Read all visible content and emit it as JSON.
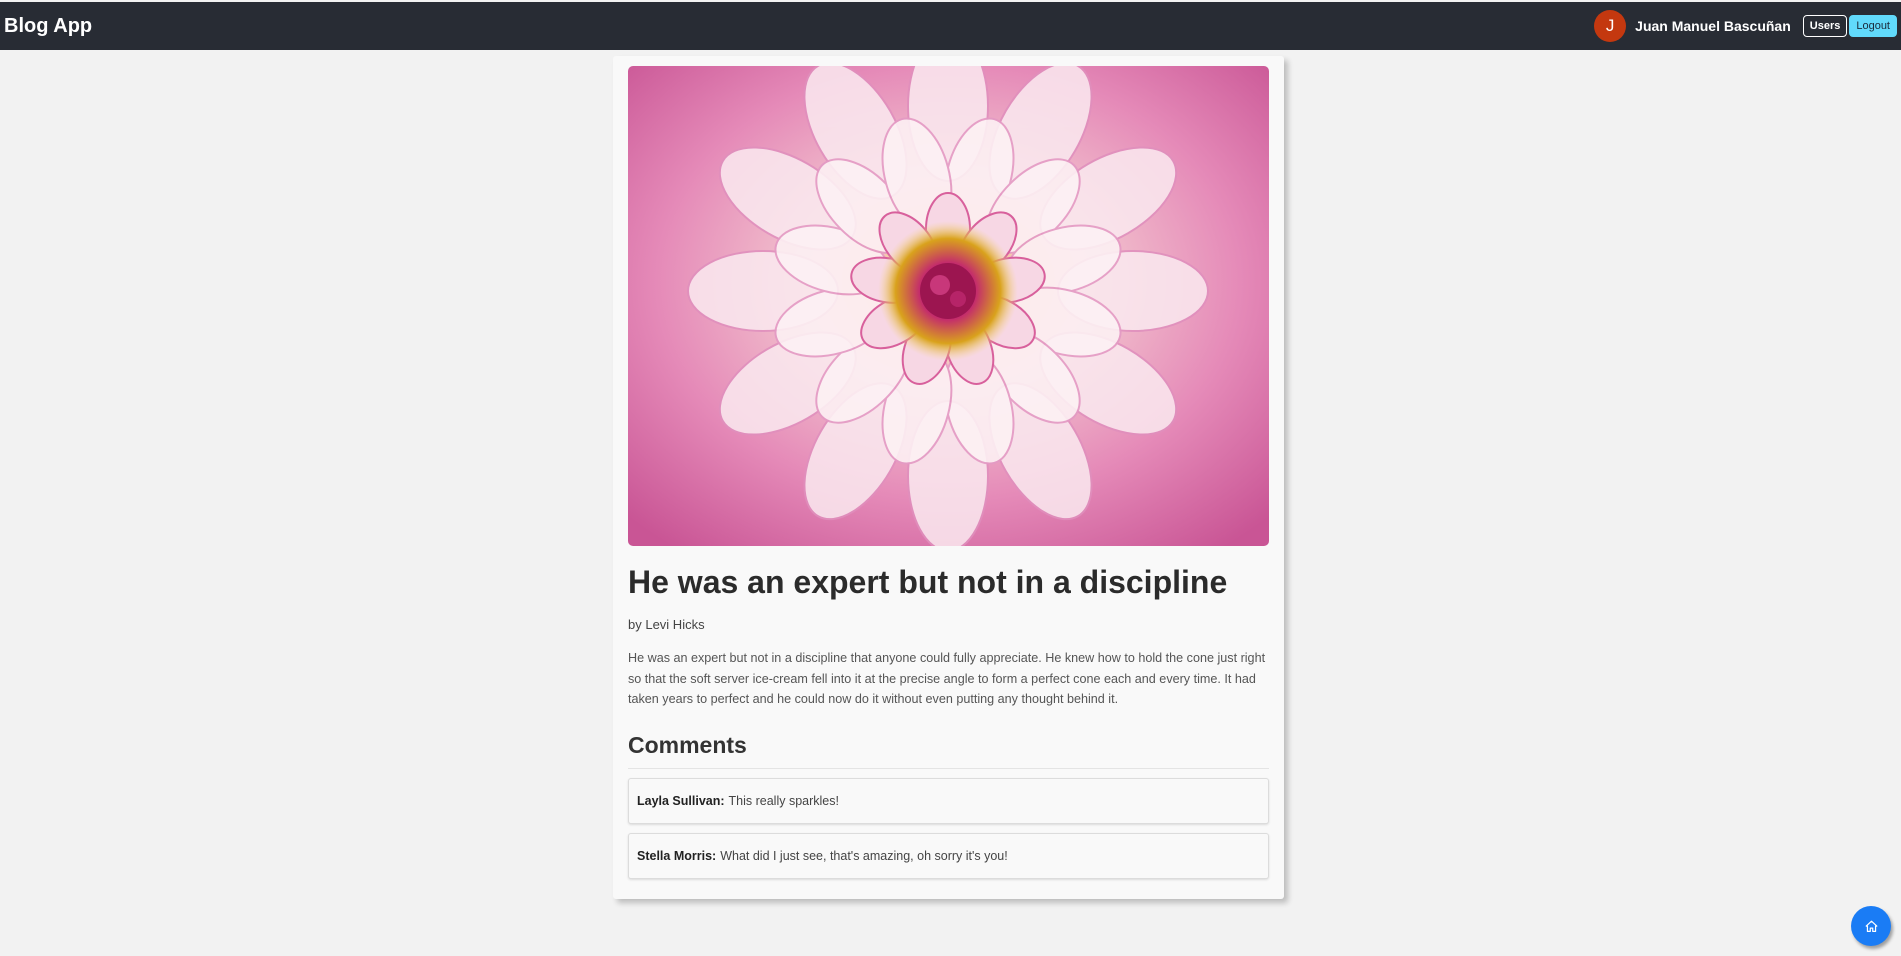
{
  "navbar": {
    "brand": "Blog App",
    "avatar_initial": "J",
    "user_name": "Juan Manuel Bascuñan",
    "users_label": "Users",
    "logout_label": "Logout"
  },
  "post": {
    "title": "He was an expert but not in a discipline",
    "author": "by Levi Hicks",
    "body": "He was an expert but not in a discipline that anyone could fully appreciate. He knew how to hold the cone just right so that the soft server ice-cream fell into it at the precise angle to form a perfect cone each and every time. It had taken years to perfect and he could now do it without even putting any thought behind it."
  },
  "comments": {
    "heading": "Comments",
    "items": [
      {
        "author": "Layla Sullivan:",
        "text": "This really sparkles!"
      },
      {
        "author": "Stella Morris:",
        "text": "What did I just see, that's amazing, oh sorry it's you!"
      }
    ]
  },
  "icons": {
    "home": "home-icon"
  },
  "colors": {
    "navbar_bg": "#282c34",
    "logout_bg": "#61dafb",
    "avatar_bg": "#c4380f",
    "fab_bg": "#1a7cf5"
  }
}
